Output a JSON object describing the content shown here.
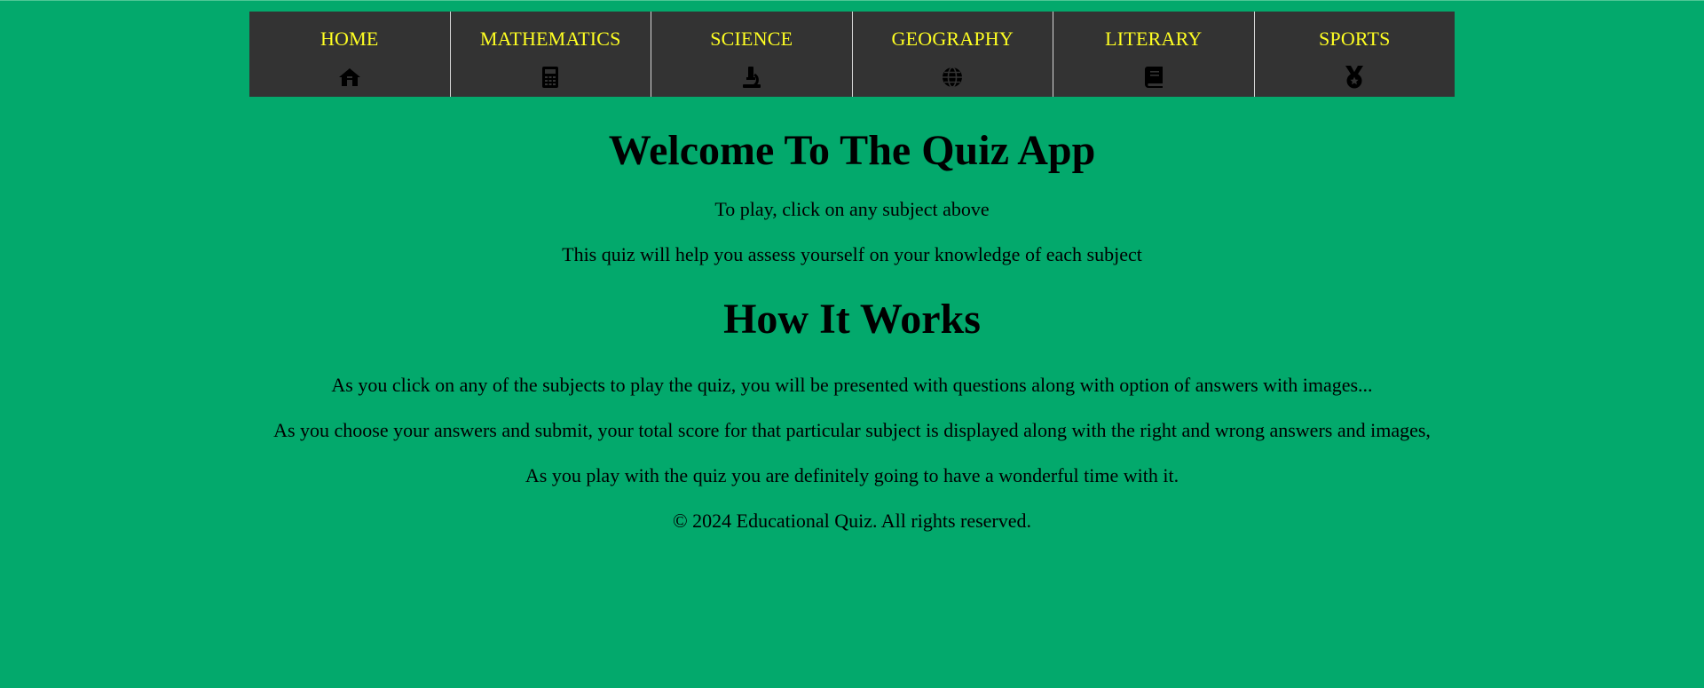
{
  "colors": {
    "background": "#03a96c",
    "nav_background": "#333333",
    "nav_text": "#ffff22",
    "text": "#000000"
  },
  "nav": {
    "items": [
      {
        "label": "HOME",
        "icon": "home-icon"
      },
      {
        "label": "MATHEMATICS",
        "icon": "calculator-icon"
      },
      {
        "label": "SCIENCE",
        "icon": "microscope-icon"
      },
      {
        "label": "GEOGRAPHY",
        "icon": "globe-icon"
      },
      {
        "label": "LITERARY",
        "icon": "book-icon"
      },
      {
        "label": "SPORTS",
        "icon": "medal-icon"
      }
    ]
  },
  "main": {
    "welcome_title": "Welcome To The Quiz App",
    "intro_1": "To play, click on any subject above",
    "intro_2": "This quiz will help you assess yourself on your knowledge of each subject",
    "how_title": "How It Works",
    "how_1": "As you click on any of the subjects to play the quiz, you will be presented with questions along with option of answers with images...",
    "how_2": "As you choose your answers and submit, your total score for that particular subject is displayed along with the right and wrong answers and images,",
    "how_3": "As you play with the quiz you are definitely going to have a wonderful time with it.",
    "footer": "© 2024 Educational Quiz. All rights reserved."
  }
}
